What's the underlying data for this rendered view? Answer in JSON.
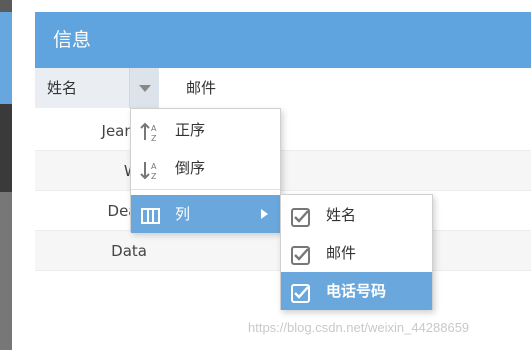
{
  "panel": {
    "title": "信息",
    "columns": {
      "name": "姓名",
      "email": "邮件"
    }
  },
  "rows": [
    "Jean L",
    "Wo",
    "Dean",
    "Data"
  ],
  "menu": {
    "items": [
      {
        "label": "正序",
        "icon": "sort-ascending-icon"
      },
      {
        "label": "倒序",
        "icon": "sort-descending-icon"
      },
      {
        "label": "列",
        "icon": "columns-icon"
      }
    ]
  },
  "submenu": {
    "items": [
      {
        "label": "姓名",
        "checked": true
      },
      {
        "label": "邮件",
        "checked": true
      },
      {
        "label": "电话号码",
        "checked": true
      }
    ]
  },
  "watermark": "https://blog.csdn.net/weixin_44288659",
  "colors": {
    "accent": "#5fa4de",
    "menu_active": "#6aa7dd"
  }
}
